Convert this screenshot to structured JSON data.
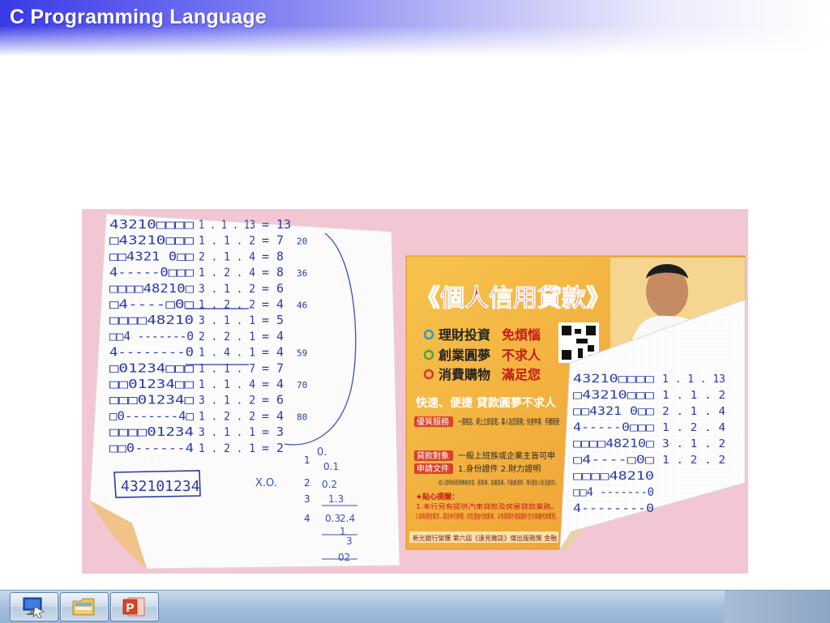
{
  "slide": {
    "title": "C Programming Language"
  },
  "photo": {
    "left_sheet": {
      "rows": [
        {
          "code": "43210□□□□",
          "expr": "1 . 1 . 13",
          "result": "= 13"
        },
        {
          "code": "□43210□□□",
          "expr": "1 . 1 . 2",
          "result": "= 7",
          "note": "20"
        },
        {
          "code": "□□4321 0□□",
          "expr": "2 . 1 . 4",
          "result": "= 8"
        },
        {
          "code": "4-----0□□□",
          "expr": "1 . 2 . 4",
          "result": "= 8",
          "note": "36"
        },
        {
          "code": "□□□□48210□",
          "expr": "3 . 1 . 2",
          "result": "= 6"
        },
        {
          "code": "□4----□0□",
          "expr": "1 . 2 . 2",
          "result": "= 4",
          "note": "46"
        },
        {
          "code": "□□□□48210",
          "expr": "3 . 1 . 1",
          "result": "= 5"
        },
        {
          "code": "□□4 -------0",
          "expr": "2 . 2 . 1",
          "result": "= 4"
        },
        {
          "code": "4--------0",
          "expr": "1 . 4 . 1",
          "result": "= 4",
          "note": "59"
        },
        {
          "code": "□01234□□□",
          "expr": "1 . 1 . 7",
          "result": "= 7"
        },
        {
          "code": "□□01234□□",
          "expr": "1 . 1 . 4",
          "result": "= 4",
          "note": "70"
        },
        {
          "code": "□□□01234□",
          "expr": "3 . 1 . 2",
          "result": "= 6"
        },
        {
          "code": "□0-------4□",
          "expr": "1 . 2 . 2",
          "result": "= 4",
          "note": "80"
        },
        {
          "code": "□□□□01234",
          "expr": "3 . 1 . 1",
          "result": "= 3"
        },
        {
          "code": "□□0------4",
          "expr": "1 . 2 . 1",
          "result": "= 2"
        }
      ],
      "boxed": "432101234",
      "small_notes": [
        "1",
        "2",
        "3",
        "4"
      ],
      "side_notes": [
        "0.",
        "0.1",
        "0.2",
        "1.3",
        "0.3",
        "X.O.",
        "2.4",
        "1",
        "3",
        "02"
      ]
    },
    "flyer": {
      "title": "《個人信用貸款》",
      "bullets": [
        {
          "lead": "理財投資",
          "accent": "免煩惱"
        },
        {
          "lead": "創業圓夢",
          "accent": "不求人"
        },
        {
          "lead": "消費購物",
          "accent": "滿足您"
        }
      ],
      "banner": "快速、便捷 貸款圓夢不求人",
      "sections": [
        {
          "tag": "優質服務",
          "text": "一通電話、網上立即留電，專人為您服務；快速申貸、手續簡便"
        },
        {
          "tag": "貸款對象",
          "text": "一般上班族或企業主皆可申"
        },
        {
          "tag": "申請文件",
          "text": "1.身份證件 2.財力證明"
        }
      ],
      "fine_print": "收入證明係薪資轉帳存摺、薪資單、扣繳憑單、不動產資料…等(證信人狀況提供)。",
      "tips_title": "★貼心提醒：",
      "tips": [
        "1.本行另有提供汽車貸款及房屋貸款業務。",
        "2.如有資金需求，請洽本行辦理，切勿透由代辦業者，以免個資外洩或額外支付高額代辦費用。"
      ],
      "footer": "新光銀行榮獲 第六屆《遠見雜誌》傑出服務獎 金融"
    }
  },
  "taskbar": {
    "buttons": [
      {
        "name": "show-desktop-icon"
      },
      {
        "name": "file-explorer-icon"
      },
      {
        "name": "powerpoint-icon",
        "glyph": "P"
      }
    ]
  },
  "colors": {
    "pink_background": "#f2c7d3",
    "flyer_orange": "#f5b33a",
    "flyer_red": "#c8181b",
    "pen_blue": "#2a3aa8"
  }
}
